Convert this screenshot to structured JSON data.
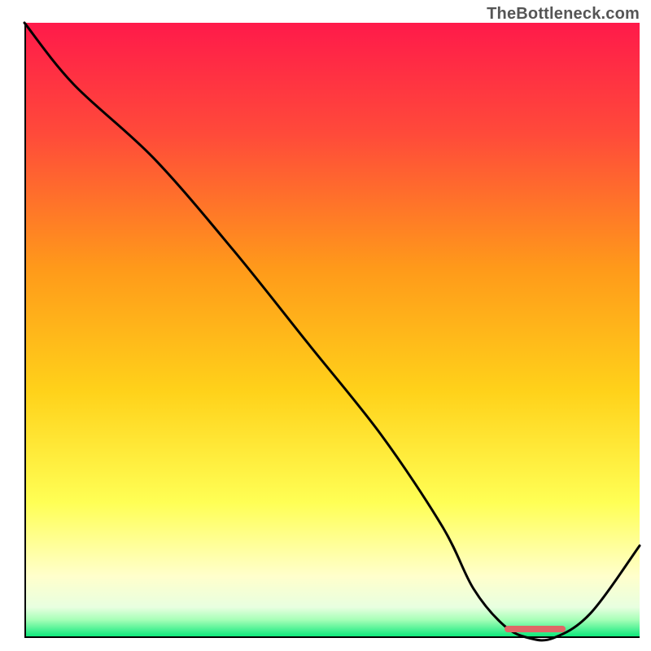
{
  "watermark": "TheBottleneck.com",
  "colors": {
    "gradient_top": "#ff1a4a",
    "gradient_mid_upper": "#ff7a2a",
    "gradient_mid": "#ffd21a",
    "gradient_lower_yellow": "#ffff66",
    "gradient_pale": "#ffffe0",
    "gradient_green_light": "#b8ffb8",
    "gradient_green": "#00e676",
    "curve": "#000000",
    "marker": "#e06666",
    "axis": "#000000",
    "watermark": "#555555"
  },
  "chart_data": {
    "type": "line",
    "title": "",
    "xlabel": "",
    "ylabel": "",
    "xlim": [
      0,
      100
    ],
    "ylim": [
      0,
      100
    ],
    "x": [
      0,
      8,
      21,
      34,
      46,
      58,
      68,
      73,
      78,
      82,
      86,
      92,
      100
    ],
    "values": [
      100,
      90,
      78,
      63,
      48,
      33,
      18,
      8,
      2,
      0,
      0,
      4,
      15
    ],
    "marker": {
      "start_x": 78,
      "end_x": 88,
      "y": 0.6
    },
    "note": "Line chart over a vertical heat gradient (red at top through orange/yellow to green at very bottom). Curve descends steeply from top-left, flattens near x≈82, then rises toward right edge. A small salmon dashed-looking marker sits on the baseline at the trough."
  }
}
